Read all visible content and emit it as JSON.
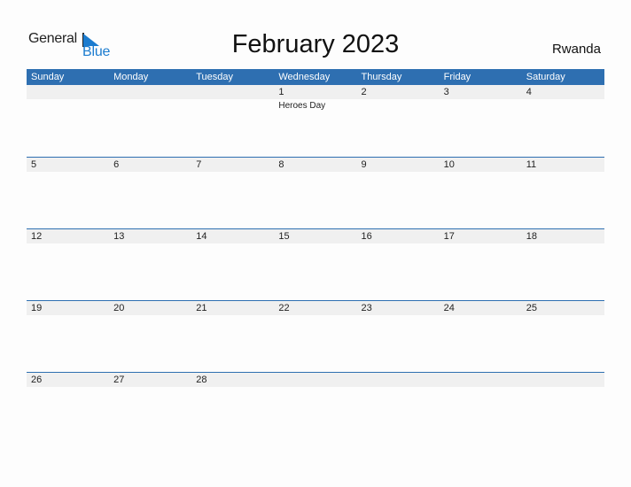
{
  "logo": {
    "word1": "General",
    "word2": "Blue"
  },
  "title": "February 2023",
  "country": "Rwanda",
  "colors": {
    "accent": "#2e6fb1",
    "logo_blue": "#1c7ccf",
    "band": "#f0f0f0"
  },
  "days": [
    "Sunday",
    "Monday",
    "Tuesday",
    "Wednesday",
    "Thursday",
    "Friday",
    "Saturday"
  ],
  "weeks": [
    {
      "dates": [
        "",
        "",
        "",
        "1",
        "2",
        "3",
        "4"
      ],
      "events": [
        "",
        "",
        "",
        "Heroes Day",
        "",
        "",
        ""
      ]
    },
    {
      "dates": [
        "5",
        "6",
        "7",
        "8",
        "9",
        "10",
        "11"
      ],
      "events": [
        "",
        "",
        "",
        "",
        "",
        "",
        ""
      ]
    },
    {
      "dates": [
        "12",
        "13",
        "14",
        "15",
        "16",
        "17",
        "18"
      ],
      "events": [
        "",
        "",
        "",
        "",
        "",
        "",
        ""
      ]
    },
    {
      "dates": [
        "19",
        "20",
        "21",
        "22",
        "23",
        "24",
        "25"
      ],
      "events": [
        "",
        "",
        "",
        "",
        "",
        "",
        ""
      ]
    },
    {
      "dates": [
        "26",
        "27",
        "28",
        "",
        "",
        "",
        ""
      ],
      "events": [
        "",
        "",
        "",
        "",
        "",
        "",
        ""
      ]
    }
  ]
}
